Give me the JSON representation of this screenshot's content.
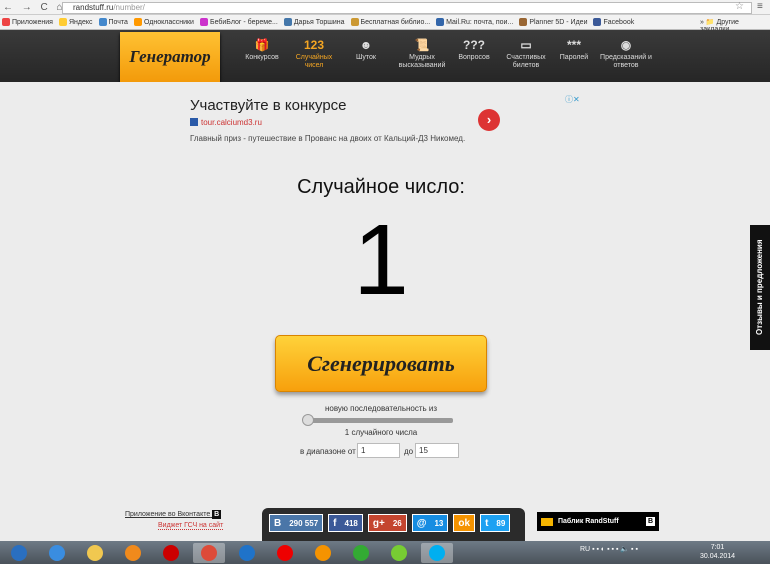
{
  "browser": {
    "url_host": "randstuff.ru",
    "url_path": "/number/",
    "bookmarks": [
      {
        "label": "Приложения",
        "color": "#e44"
      },
      {
        "label": "Яндекс",
        "color": "#fc3"
      },
      {
        "label": "Почта",
        "color": "#48c"
      },
      {
        "label": "Одноклассники",
        "color": "#f90"
      },
      {
        "label": "БебиБлог - береме...",
        "color": "#c3c"
      },
      {
        "label": "Дарья Торшина",
        "color": "#47a"
      },
      {
        "label": "Бесплатная библио...",
        "color": "#c93"
      },
      {
        "label": "Mail.Ru: почта, пои...",
        "color": "#36a"
      },
      {
        "label": "Planner 5D - Идеи",
        "color": "#963"
      },
      {
        "label": "Facebook",
        "color": "#3b5998"
      }
    ],
    "other_bookmarks": "Другие закладки"
  },
  "header": {
    "logo": "Генератор",
    "nav": [
      {
        "icon": "gift-icon",
        "glyph": "🎁",
        "label": "Конкурсов"
      },
      {
        "icon": "numbers-icon",
        "glyph": "123",
        "label": "Случайных чисел",
        "active": true
      },
      {
        "icon": "smiley-icon",
        "glyph": "☻",
        "label": "Шуток"
      },
      {
        "icon": "scroll-icon",
        "glyph": "📜",
        "label": "Мудрых высказываний"
      },
      {
        "icon": "question-icon",
        "glyph": "???",
        "label": "Вопросов"
      },
      {
        "icon": "ticket-icon",
        "glyph": "▭",
        "label": "Счастливых билетов"
      },
      {
        "icon": "password-icon",
        "glyph": "***",
        "label": "Паролей"
      },
      {
        "icon": "ball-icon",
        "glyph": "◉",
        "label": "Предсказаний и ответов"
      }
    ]
  },
  "ad": {
    "title": "Участвуйте в конкурсе",
    "url": "tour.calciumd3.ru",
    "desc": "Главный приз - путешествие в Прованс на двоих от Кальций-Д3 Никомед."
  },
  "main": {
    "title": "Случайное число:",
    "number": "1",
    "generate": "Сгенерировать",
    "seq_label": "новую последовательность из",
    "slider_value": 1,
    "count_label": "1 случайного числа",
    "range_from_label": "в диапазоне от",
    "from": "1",
    "to_label": "до",
    "to": "15"
  },
  "feedback": "Отзывы и предложения",
  "footer": {
    "vk_app": "Приложение во Вконтакте",
    "widget": "Виджет ГСЧ на сайт",
    "social": [
      {
        "name": "vk",
        "glyph": "B",
        "count": "290 557",
        "color": "#4a76a8"
      },
      {
        "name": "facebook",
        "glyph": "f",
        "count": "418",
        "color": "#3b5998"
      },
      {
        "name": "google-plus",
        "glyph": "g+",
        "count": "26",
        "color": "#c4452f"
      },
      {
        "name": "mailru",
        "glyph": "@",
        "count": "13",
        "color": "#168de2"
      },
      {
        "name": "odnoklassniki",
        "glyph": "ok",
        "count": "",
        "color": "#f59300"
      },
      {
        "name": "twitter",
        "glyph": "t",
        "count": "89",
        "color": "#1da1f2"
      }
    ],
    "public": "Паблик RandStuff"
  },
  "taskbar": {
    "lang": "RU",
    "time": "7:01",
    "date": "30.04.2014"
  }
}
